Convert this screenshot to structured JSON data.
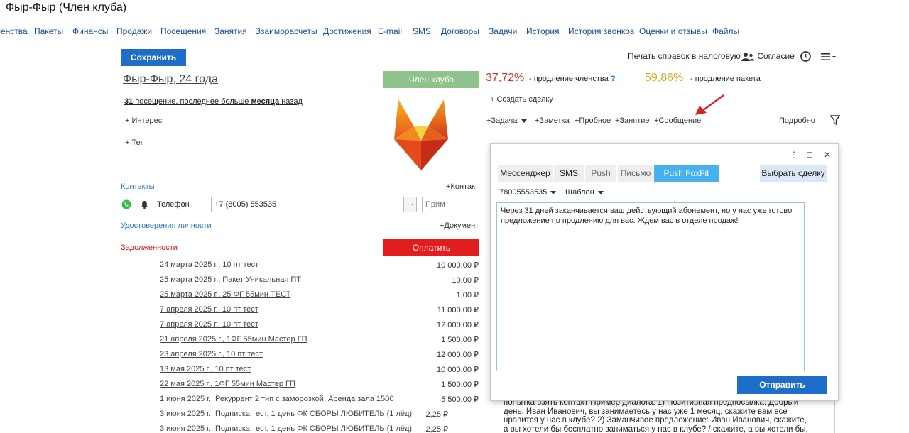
{
  "page": {
    "title": "Фыр-Фыр (Член клуба)"
  },
  "nav": {
    "items": [
      "ленства",
      "Пакеты",
      "Финансы",
      "Продажи",
      "Посещения",
      "Занятия",
      "Взаиморасчеты",
      "Достижения",
      "E-mail",
      "SMS",
      "Договоры",
      "Задачи",
      "История",
      "История звонков",
      "Оценки и отзывы",
      "Файлы"
    ]
  },
  "toolbar": {
    "save_label": "Сохранить",
    "tax_label": "Печать справок в налоговую",
    "consent_label": "Согласие"
  },
  "client": {
    "name": "Фыр-Фыр, 24 года",
    "status_badge": "Член клуба",
    "visits_count": "31",
    "visits_mid": " посещение, последнее больше ",
    "visits_bold": "месяца",
    "visits_tail": " назад",
    "interest_label": "+ Интерес",
    "tag_label": "+ Тег"
  },
  "renewal": {
    "membership_pct": "37,72%",
    "membership_text": "- продление членства",
    "help": "?",
    "package_pct": "59,86%",
    "package_text": "- продление пакета",
    "create_deal": "+ Создать сделку"
  },
  "actions": {
    "task": "+Задача",
    "note": "+Заметка",
    "trial": "+Пробное",
    "lesson": "+Занятие",
    "message": "+Сообщение",
    "details": "Подробно"
  },
  "contacts": {
    "section_label": "Контакты",
    "add_label": "+Контакт",
    "phone_label": "Телефон",
    "phone_value": "+7 (8005) 553535",
    "dots": "...",
    "note_placeholder": "Прим"
  },
  "identity": {
    "section_label": "Удостоверения личности",
    "add_label": "+Документ"
  },
  "debts": {
    "section_label": "Задолженности",
    "pay_label": "Оплатить",
    "rows": [
      {
        "label": "24 марта 2025 г., 10 пт тест",
        "amount": "10 000,00 ₽"
      },
      {
        "label": "25 марта 2025 г., Пакет Уникальная ПТ",
        "amount": "10,00 ₽"
      },
      {
        "label": "25 марта 2025 г., 25 ФГ 55мин ТЕСТ",
        "amount": "1,00 ₽"
      },
      {
        "label": "7 апреля 2025 г., 10 пт тест",
        "amount": "11 000,00 ₽"
      },
      {
        "label": "7 апреля 2025 г., 10 пт тест",
        "amount": "12 000,00 ₽"
      },
      {
        "label": "21 апреля 2025 г., 1ФГ 55мин Мастер ГП",
        "amount": "1 500,00 ₽"
      },
      {
        "label": "23 апреля 2025 г., 10 пт тест",
        "amount": "12 000,00 ₽"
      },
      {
        "label": "13 мая 2025 г., 10 пт тест",
        "amount": "10 000,00 ₽"
      },
      {
        "label": "22 мая 2025 г., 1ФГ 55мин Мастер ГП",
        "amount": "1 500,00 ₽"
      },
      {
        "label": "1 июня 2025 г., Рекуррент 2 тип с заморозкой, Аренда зала 1500",
        "amount": "5 500,00 ₽"
      },
      {
        "label": "3 июня 2025 г., Подписка тест, 1 день ФК СБОРЫ ЛЮБИТЕЛЬ (1 лёд)",
        "amount": "2,25 ₽"
      },
      {
        "label": "3 июня 2025 г., Подписка тест, 1 день ФК СБОРЫ ЛЮБИТЕЛЬ (1 лёд)",
        "amount": "2,25 ₽"
      }
    ]
  },
  "background_text": {
    "lines": [
      "попытка взять контакт Пример диалога: 1) Позитивная предпосылка: Добрый",
      "день, Иван Иванович, вы занимаетесь у нас уже 1 месяц, скажите вам все",
      "нравится у нас в клубе? 2) Заманчивое предложение: Иван Иванович, скажите,",
      "а вы хотели бы бесплатно заниматься у нас в клубе? / скажите, а вы хотели бы,"
    ]
  },
  "modal": {
    "menu": "⋮",
    "maximize": "☐",
    "close": "✕",
    "tabs": [
      "Мессенджер",
      "SMS",
      "Push",
      "Письмо",
      "Push FoxFit"
    ],
    "pick_deal": "Выбрать сделку",
    "phone": "78005553535",
    "template": "Шаблон",
    "message": "Через 31 дней заканчивается ваш действующий абонемент, но у нас уже готово предложение по продлению для вас. Ждем вас в отделе продаж!",
    "send": "Отправить"
  },
  "colors": {
    "primary": "#1e6ec9",
    "badge_green": "#8fc38b",
    "pay_red": "#e31d1d",
    "tab_active": "#47b0ee",
    "pct_red": "#d42a2a",
    "pct_yellow": "#d9a91a",
    "link_blue": "#2a78c7"
  }
}
